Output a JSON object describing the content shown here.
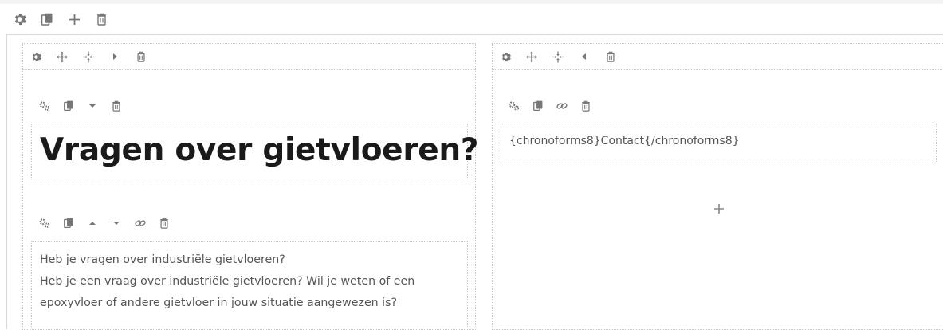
{
  "main_toolbar": {
    "icons": [
      "gear-icon",
      "copy-icon",
      "plus-icon",
      "trash-icon"
    ]
  },
  "left_column": {
    "toolbar_icons": [
      "gear-icon",
      "move-icon",
      "resize-icon",
      "caret-right-icon",
      "trash-icon"
    ],
    "heading_element": {
      "toolbar_icons": [
        "gears-icon",
        "copy-icon",
        "caret-down-icon",
        "trash-icon"
      ],
      "text": "Vragen over gietvloeren?"
    },
    "text_element": {
      "toolbar_icons": [
        "gears-icon",
        "copy-icon",
        "caret-up-icon",
        "caret-down-icon",
        "link-icon",
        "trash-icon"
      ],
      "line1": "Heb je vragen over industriële gietvloeren?",
      "line2": "Heb je een vraag over industriële gietvloeren? Wil je weten of een",
      "line3": "epoxyvloer of andere gietvloer in jouw situatie aangewezen is?"
    }
  },
  "right_column": {
    "toolbar_icons": [
      "gear-icon",
      "move-icon",
      "resize-icon",
      "caret-left-icon",
      "trash-icon"
    ],
    "form_element": {
      "toolbar_icons": [
        "gears-icon",
        "copy-icon",
        "link-icon",
        "trash-icon"
      ],
      "shortcode": "{chronoforms8}Contact{/chronoforms8}"
    },
    "add_element_icon": "plus-icon"
  },
  "colors": {
    "icon": "#777777",
    "border": "#c9c9c9",
    "heading": "#1a1a1a",
    "text": "#555555"
  }
}
